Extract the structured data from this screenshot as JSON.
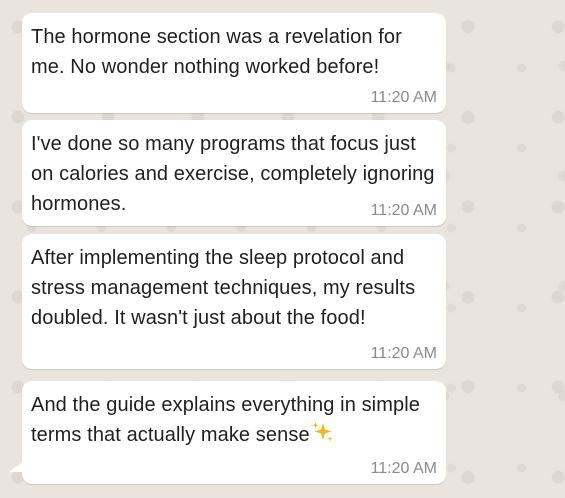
{
  "messages": [
    {
      "text": "The hormone section was a revelation for me. No wonder nothing worked before!",
      "time": "11:20 AM"
    },
    {
      "text": "I've done so many programs that focus just on calories and exercise, completely ignoring hormones.",
      "time": "11:20 AM"
    },
    {
      "text": "After implementing the sleep protocol and stress management techniques, my results doubled. It wasn't just about the food!",
      "time": "11:20 AM"
    },
    {
      "text": "And the guide explains everything in simple terms that actually make sense",
      "emoji": "sparkles",
      "time": "11:20 AM"
    }
  ],
  "colors": {
    "background": "#e9e4dd",
    "bubble": "#ffffff",
    "text": "#1f1f1f",
    "time": "#8a8a8a",
    "sparkle": "#f5b625"
  }
}
